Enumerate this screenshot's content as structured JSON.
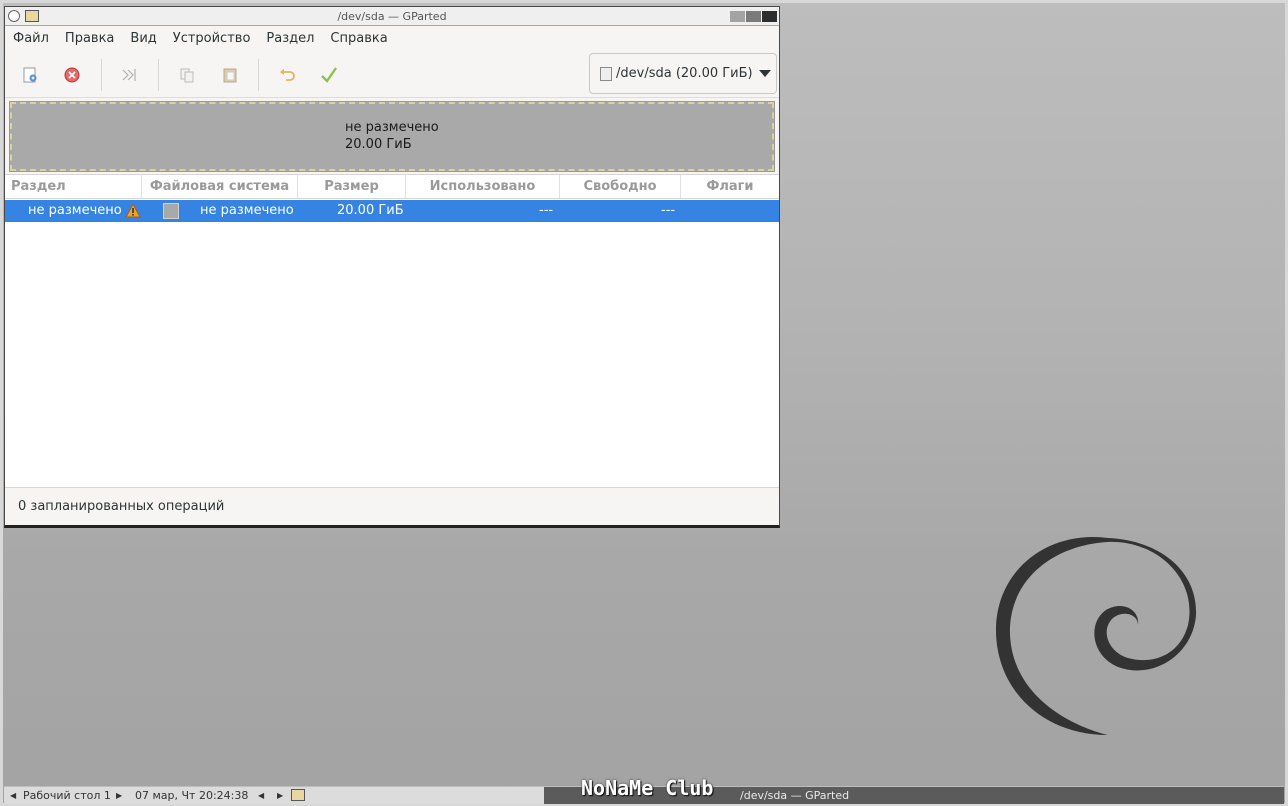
{
  "window": {
    "title": "/dev/sda — GParted"
  },
  "menubar": {
    "items": [
      "Файл",
      "Правка",
      "Вид",
      "Устройство",
      "Раздел",
      "Справка"
    ]
  },
  "toolbar": {
    "icons": [
      "new-partition-icon",
      "delete-partition-icon",
      "resize-move-icon",
      "copy-icon",
      "paste-icon",
      "undo-icon",
      "apply-icon"
    ],
    "device_selector": "/dev/sda (20.00 ГиБ)"
  },
  "disk_map": {
    "label": "не размечено",
    "size": "20.00 ГиБ"
  },
  "table": {
    "columns": [
      "Раздел",
      "Файловая система",
      "Размер",
      "Использовано",
      "Свободно",
      "Флаги"
    ],
    "rows": [
      {
        "partition": "не размечено",
        "filesystem": "не размечено",
        "size": "20.00 ГиБ",
        "used": "---",
        "free": "---",
        "flags": ""
      }
    ]
  },
  "statusbar": {
    "text": "0 запланированных операций"
  },
  "taskbar": {
    "desktop": "Рабочий стол 1",
    "datetime": "07 мар, Чт 20:24:38",
    "window_title": "/dev/sda — GParted"
  },
  "watermark": "NoNaMe Club",
  "colors": {
    "selection": "#3584e4",
    "unallocated": "#a9a9a9",
    "desktop": "#b3b3b3"
  }
}
